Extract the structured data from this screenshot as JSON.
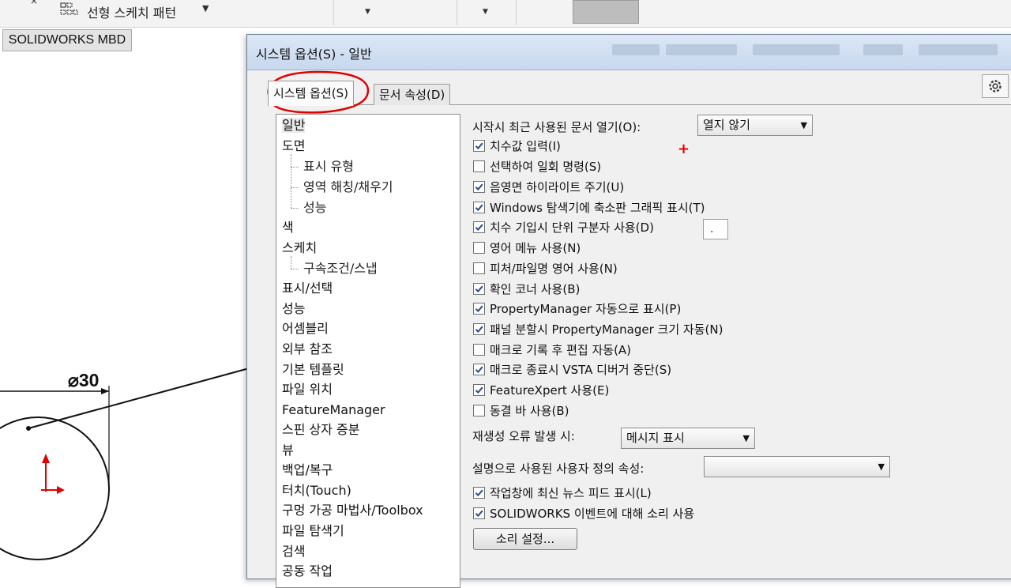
{
  "ribbon": {
    "sketch_pattern_label": "선형 스케치 패턴",
    "caret": "▼",
    "top_mark": "×"
  },
  "mbd_tab_label": "SOLIDWORKS MBD",
  "drawing": {
    "dimension_label": "⌀30"
  },
  "dialog": {
    "title": "시스템 옵션(S) - 일반",
    "tabs": [
      {
        "label": "시스템 옵션(S)",
        "active": true
      },
      {
        "label": "문서 속성(D)",
        "active": false
      }
    ],
    "tree": [
      {
        "label": "일반",
        "level": 0,
        "selected": true
      },
      {
        "label": "도면",
        "level": 0
      },
      {
        "label": "표시 유형",
        "level": 1
      },
      {
        "label": "영역 해칭/채우기",
        "level": 1
      },
      {
        "label": "성능",
        "level": 1
      },
      {
        "label": "색",
        "level": 0
      },
      {
        "label": "스케치",
        "level": 0
      },
      {
        "label": "구속조건/스냅",
        "level": 1
      },
      {
        "label": "표시/선택",
        "level": 0
      },
      {
        "label": "성능",
        "level": 0
      },
      {
        "label": "어셈블리",
        "level": 0
      },
      {
        "label": "외부 참조",
        "level": 0
      },
      {
        "label": "기본 템플릿",
        "level": 0
      },
      {
        "label": "파일 위치",
        "level": 0
      },
      {
        "label": "FeatureManager",
        "level": 0
      },
      {
        "label": "스핀 상자 증분",
        "level": 0
      },
      {
        "label": "뷰",
        "level": 0
      },
      {
        "label": "백업/복구",
        "level": 0
      },
      {
        "label": "터치(Touch)",
        "level": 0
      },
      {
        "label": "구멍 가공 마법사/Toolbox",
        "level": 0
      },
      {
        "label": "파일 탐색기",
        "level": 0
      },
      {
        "label": "검색",
        "level": 0
      },
      {
        "label": "공동 작업",
        "level": 0
      }
    ],
    "open_recent_label": "시작시 최근 사용된 문서 열기(O):",
    "open_recent_value": "열지 않기",
    "checkboxes": [
      {
        "label": "치수값 입력(I)",
        "checked": true
      },
      {
        "label": "선택하여 일회 명령(S)",
        "checked": false
      },
      {
        "label": "음영면 하이라이트 주기(U)",
        "checked": true
      },
      {
        "label": "Windows 탐색기에 축소판 그래픽 표시(T)",
        "checked": true
      },
      {
        "label": "치수 기입시 단위 구분자 사용(D)",
        "checked": true
      },
      {
        "label": "영어 메뉴 사용(N)",
        "checked": false
      },
      {
        "label": "피처/파일명 영어 사용(N)",
        "checked": false
      },
      {
        "label": "확인 코너 사용(B)",
        "checked": true
      },
      {
        "label": "PropertyManager 자동으로 표시(P)",
        "checked": true
      },
      {
        "label": "패널 분할시 PropertyManager 크기 자동(N)",
        "checked": true
      },
      {
        "label": "매크로 기록 후 편집 자동(A)",
        "checked": false
      },
      {
        "label": "매크로 종료시 VSTA 디버거 중단(S)",
        "checked": true
      },
      {
        "label": "FeatureXpert 사용(E)",
        "checked": true
      },
      {
        "label": "동결 바 사용(B)",
        "checked": false
      }
    ],
    "unit_separator_value": ".",
    "rebuild_error_label": "재생성 오류 발생 시:",
    "rebuild_error_value": "메시지 표시",
    "custom_property_label": "설명으로 사용된 사용자 정의 속성:",
    "custom_property_value": "",
    "news_feed": {
      "label": "작업창에 최신 뉴스 피드 표시(L)",
      "checked": true
    },
    "sound_events": {
      "label": "SOLIDWORKS 이벤트에 대해 소리 사용",
      "checked": true
    },
    "sound_settings_button": "소리 설정...",
    "marker": "+"
  },
  "colors": {
    "title_bar": "#c7d8ee",
    "annotation_red": "#e00000",
    "dialog_bg": "#f0f0f0"
  }
}
